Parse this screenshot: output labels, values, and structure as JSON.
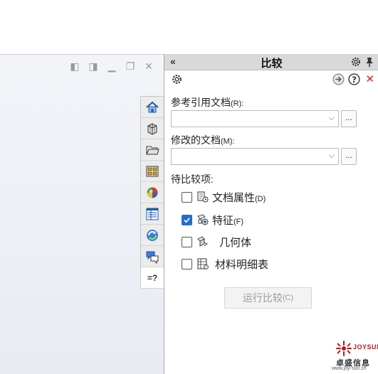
{
  "panel": {
    "collapse_glyph": "«",
    "title": "比较"
  },
  "reference_doc": {
    "label": "参考引用文档",
    "shortcut": "(R):",
    "value": "",
    "browse_label": "..."
  },
  "modified_doc": {
    "label": "修改的文档",
    "shortcut": "(M):",
    "value": "",
    "browse_label": "..."
  },
  "items_section": {
    "label": "待比较项:"
  },
  "items": [
    {
      "label": "文档属性",
      "shortcut": "(D)",
      "checked": false,
      "icon": "document-properties-icon"
    },
    {
      "label": "特征",
      "shortcut": "(F)",
      "checked": true,
      "icon": "feature-icon"
    },
    {
      "label": "几何体",
      "shortcut": "",
      "checked": false,
      "icon": "geometry-icon"
    },
    {
      "label": "材料明细表",
      "shortcut": "",
      "checked": false,
      "icon": "bom-icon"
    }
  ],
  "run_button": {
    "label": "运行比较",
    "shortcut": "(C)",
    "enabled": false
  },
  "task_tabs": [
    {
      "icon": "home-icon"
    },
    {
      "icon": "parts-library-icon"
    },
    {
      "icon": "folder-icon"
    },
    {
      "icon": "view-palette-icon"
    },
    {
      "icon": "appearance-icon"
    },
    {
      "icon": "custom-properties-icon"
    },
    {
      "icon": "refresh-sync-icon"
    },
    {
      "icon": "forum-icon"
    },
    {
      "icon": "compare-icon",
      "text": "=?",
      "active": true
    }
  ],
  "watermark": {
    "brand": "JOYSUN",
    "name": "卓盛信息",
    "url": "www.joy-sun.cn"
  },
  "colors": {
    "accent": "#1f6fd1",
    "close": "#d22222",
    "brand_red": "#c4131b"
  }
}
